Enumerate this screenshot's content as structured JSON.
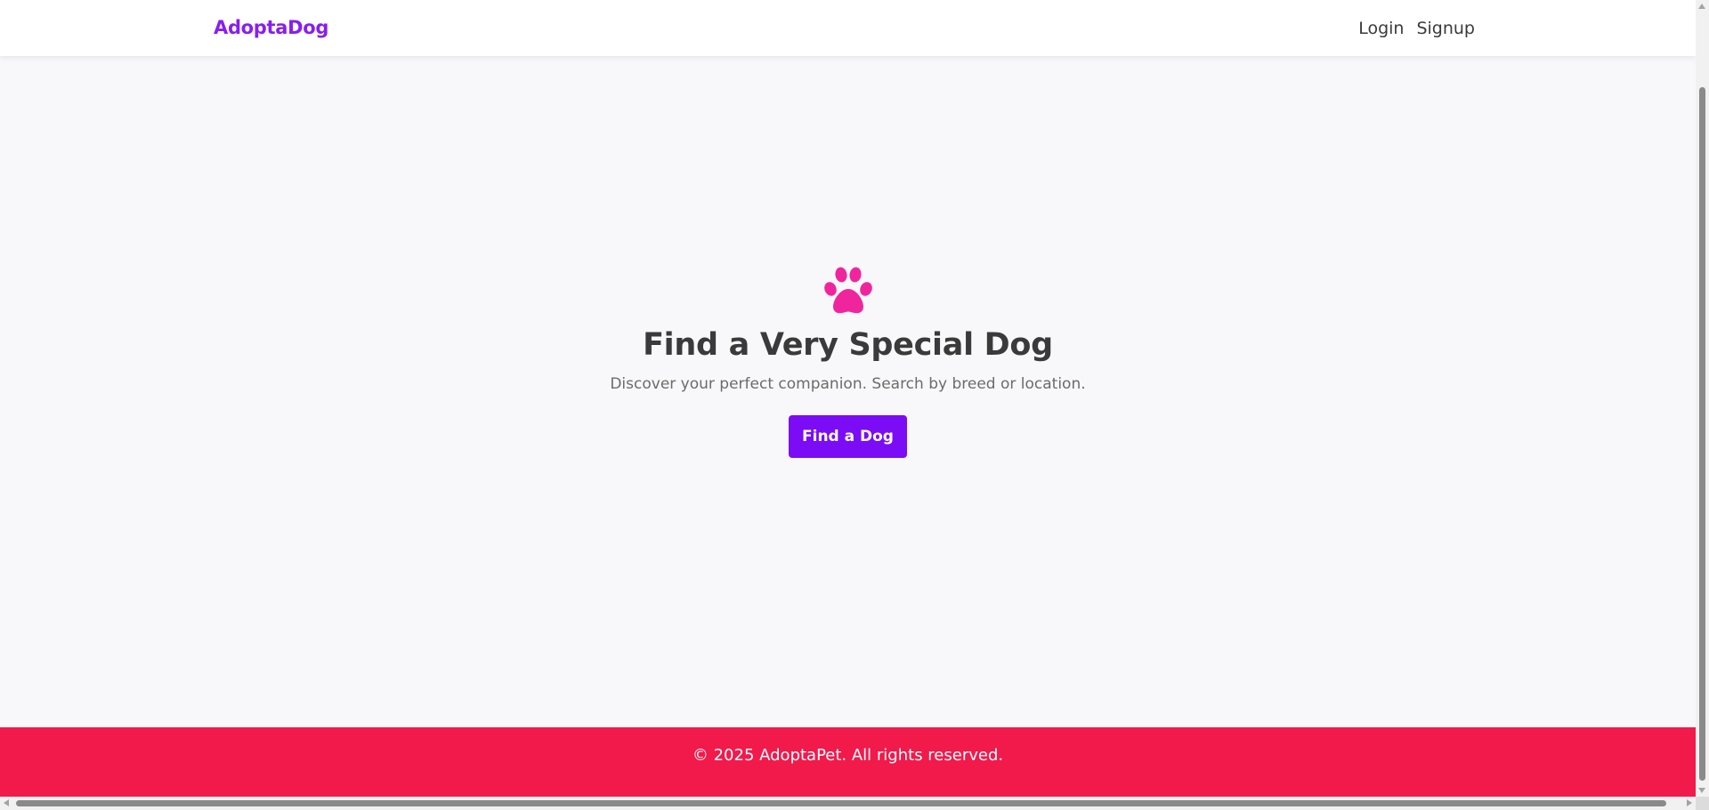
{
  "header": {
    "brand": "AdoptaDog",
    "nav": [
      {
        "label": "Login"
      },
      {
        "label": "Signup"
      }
    ]
  },
  "hero": {
    "icon": "paw-icon",
    "title": "Find a Very Special Dog",
    "subtitle": "Discover your perfect companion. Search by breed or location.",
    "cta_label": "Find a Dog"
  },
  "footer": {
    "text": "© 2025 AdoptaPet. All rights reserved."
  },
  "colors": {
    "brand": "#8a1df0",
    "cta": "#7b0cf5",
    "paw": "#f0259e",
    "footer": "#f2194b",
    "background": "#f8f8fa"
  }
}
